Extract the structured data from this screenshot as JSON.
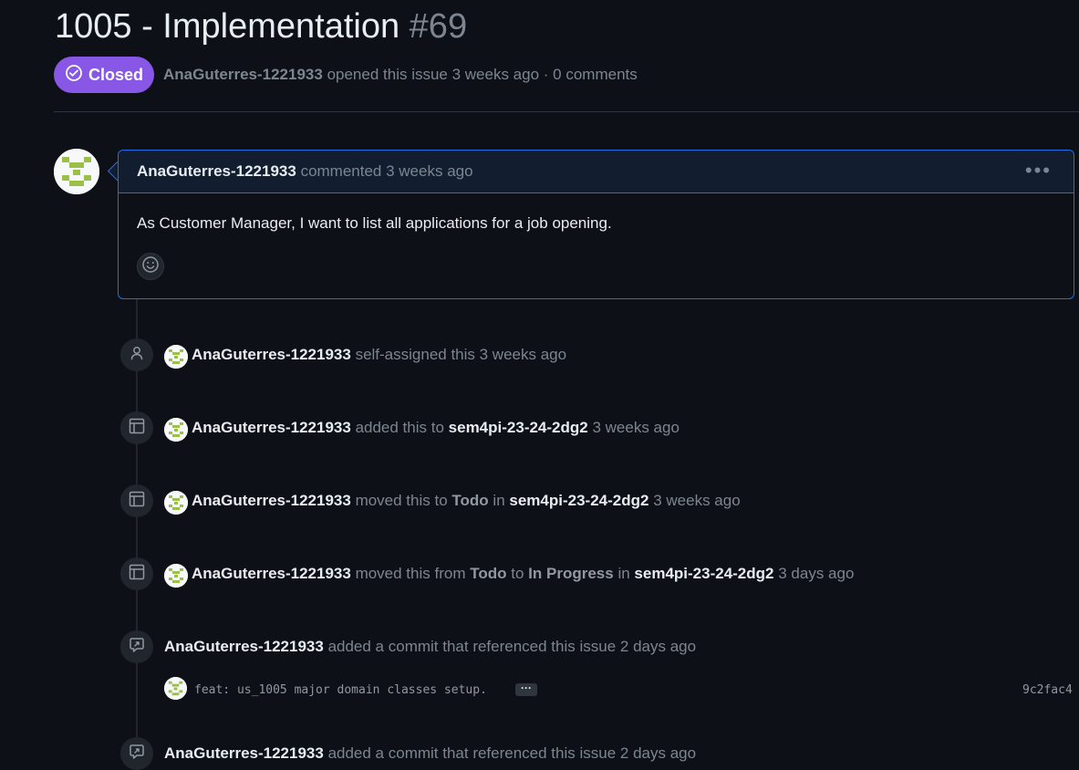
{
  "issue": {
    "title": "1005 - Implementation",
    "number": "#69",
    "state": "Closed",
    "author": "AnaGuterres-1221933",
    "meta_text": "opened this issue 3 weeks ago · 0 comments"
  },
  "comment": {
    "author": "AnaGuterres-1221933",
    "action": "commented 3 weeks ago",
    "menu": "•••",
    "body": "As Customer Manager, I want to list all applications for a job opening."
  },
  "events": [
    {
      "user": "AnaGuterres-1221933",
      "pre": "self-assigned this 3 weeks ago"
    },
    {
      "user": "AnaGuterres-1221933",
      "pre": "added this to",
      "project": "sem4pi-23-24-2dg2",
      "time": "3 weeks ago"
    },
    {
      "user": "AnaGuterres-1221933",
      "pre": "moved this to",
      "col1": "Todo",
      "mid": "in",
      "project": "sem4pi-23-24-2dg2",
      "time": "3 weeks ago"
    },
    {
      "user": "AnaGuterres-1221933",
      "pre": "moved this from",
      "col1": "Todo",
      "to": "to",
      "col2": "In Progress",
      "mid": "in",
      "project": "sem4pi-23-24-2dg2",
      "time": "3 days ago"
    },
    {
      "user": "AnaGuterres-1221933",
      "pre": "added a commit that referenced this issue 2 days ago"
    },
    {
      "user": "AnaGuterres-1221933",
      "pre": "added a commit that referenced this issue 2 days ago"
    }
  ],
  "commit": {
    "message": "feat: us_1005 major domain classes setup.",
    "ellipsis": "···",
    "sha": "9c2fac4"
  }
}
